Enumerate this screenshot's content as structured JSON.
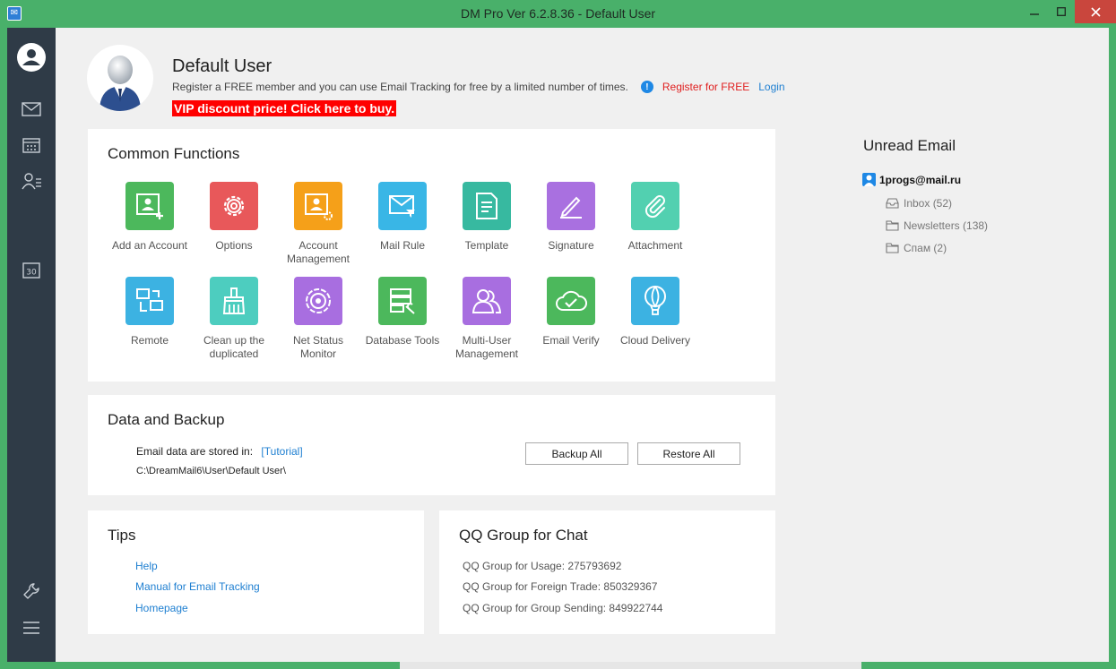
{
  "window": {
    "title": "DM Pro Ver 6.2.8.36  -  Default User"
  },
  "user": {
    "name": "Default User",
    "register_text": "Register a FREE member and you can use Email Tracking for free by a limited number of  times.",
    "register_link": "Register for FREE",
    "login_link": "Login",
    "vip_text": "VIP discount price! Click here to buy."
  },
  "common_functions": {
    "title": "Common Functions",
    "items": [
      {
        "label": "Add an Account",
        "icon": "add-account-icon",
        "color": "#4cb85c"
      },
      {
        "label": "Options",
        "icon": "gear-icon",
        "color": "#e8585a"
      },
      {
        "label": "Account Management",
        "icon": "account-settings-icon",
        "color": "#f5a019"
      },
      {
        "label": "Mail Rule",
        "icon": "mail-filter-icon",
        "color": "#39b6e6"
      },
      {
        "label": "Template",
        "icon": "document-icon",
        "color": "#37b9a0"
      },
      {
        "label": "Signature",
        "icon": "pen-icon",
        "color": "#a970e0"
      },
      {
        "label": "Attachment",
        "icon": "paperclip-icon",
        "color": "#52d0b0"
      },
      {
        "label": "Remote",
        "icon": "remote-icon",
        "color": "#3cb2e2"
      },
      {
        "label": "Clean up the duplicated",
        "icon": "broom-icon",
        "color": "#4dcdbf"
      },
      {
        "label": "Net Status Monitor",
        "icon": "target-icon",
        "color": "#a86ee0"
      },
      {
        "label": "Database Tools",
        "icon": "database-tools-icon",
        "color": "#4cb85c"
      },
      {
        "label": "Multi-User Management",
        "icon": "users-icon",
        "color": "#a86ee0"
      },
      {
        "label": "Email Verify",
        "icon": "cloud-check-icon",
        "color": "#4cb85c"
      },
      {
        "label": "Cloud Delivery",
        "icon": "balloon-icon",
        "color": "#3cb2e2"
      }
    ]
  },
  "data_backup": {
    "title": "Data and Backup",
    "stored_label": "Email data are stored in:",
    "tutorial_link": "[Tutorial]",
    "path": "C:\\DreamMail6\\User\\Default User\\",
    "backup_button": "Backup All",
    "restore_button": "Restore All"
  },
  "tips": {
    "title": "Tips",
    "links": [
      "Help",
      "Manual for Email Tracking",
      "Homepage"
    ]
  },
  "qq": {
    "title": "QQ Group for Chat",
    "lines": [
      "QQ Group for Usage: 275793692",
      "QQ Group for Foreign Trade: 850329367",
      "QQ Group for Group Sending: 849922744"
    ]
  },
  "unread": {
    "title": "Unread Email",
    "account": "1progs@mail.ru",
    "folders": [
      {
        "label": "Inbox (52)",
        "icon": "inbox-icon"
      },
      {
        "label": "Newsletters (138)",
        "icon": "folder-icon"
      },
      {
        "label": "Спам (2)",
        "icon": "folder-icon"
      }
    ]
  },
  "sidebar": {
    "items": [
      {
        "icon": "user-avatar-icon"
      },
      {
        "icon": "mail-icon"
      },
      {
        "icon": "calendar-icon"
      },
      {
        "icon": "contacts-icon"
      },
      {
        "icon": "date-30-icon"
      },
      {
        "icon": "wrench-icon"
      },
      {
        "icon": "menu-icon"
      }
    ]
  },
  "colors": {
    "window_frame": "#49b06a",
    "sidebar": "#2f3b47",
    "vip_bg": "#ff0000",
    "link": "#1e7fd1",
    "register_link": "#e02020"
  }
}
